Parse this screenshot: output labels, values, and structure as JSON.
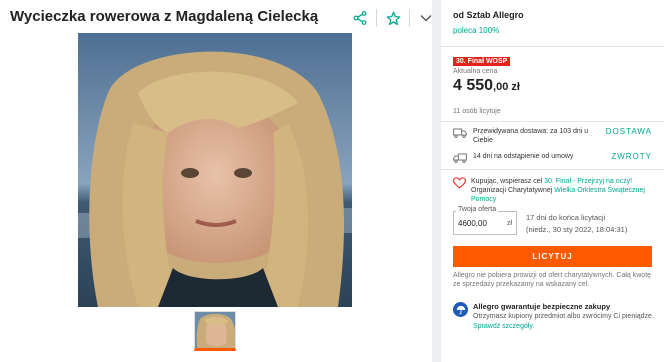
{
  "listing": {
    "title": "Wycieczka rowerowa z Magdaleną Cielecką"
  },
  "icons": {
    "share": "share-icon",
    "favorite": "star-icon",
    "more": "chevron-down-icon",
    "delivery": "truck-icon",
    "returns": "return-truck-icon",
    "charity": "heart-icon",
    "guarantee": "umbrella-icon"
  },
  "seller": {
    "name": "od Sztab Allegro",
    "recommend": "poleca 100%"
  },
  "pricing": {
    "badge": "30. Finał WOŚP",
    "label": "Aktualna cena",
    "amount": "4 550",
    "cents": ",00 zł",
    "bidders": "11 osób licytuje"
  },
  "delivery": {
    "text": "Przewidywana dostawa: za 103 dni u Ciebie",
    "link": "DOSTAWA"
  },
  "returns": {
    "text": "14 dni na odstąpienie od umowy",
    "link": "ZWROTY"
  },
  "charity": {
    "part1": "Kupując, wspierasz cel",
    "goal": "30. Finał - Przejrzyj na oczy!",
    "part2": "Organizacji Charytatywnej",
    "org": "Wielka Orkiestra Świątecznej Pomocy"
  },
  "bid": {
    "label": "Twoja oferta",
    "value": "4600,00",
    "unit": "zł",
    "time_left": "17 dni do końca licytacji",
    "end_date": "(niedz., 30 sty 2022, 18:04:31)",
    "button": "LICYTUJ"
  },
  "note": "Allegro nie pobiera prowizji od ofert charytatywnych. Całą kwotę ze sprzedaży przekazamy na wskazany cel.",
  "guarantee": {
    "title": "Allegro gwarantuje bezpieczne zakupy",
    "text": "Otrzymasz kupiony przedmiot albo zwrócimy Ci pieniądze.",
    "link": "Sprawdź szczegóły."
  },
  "colors": {
    "accent": "#ff5a00",
    "link": "#00a790",
    "badge": "#e1231a",
    "guarantee": "#1c5bb7"
  }
}
